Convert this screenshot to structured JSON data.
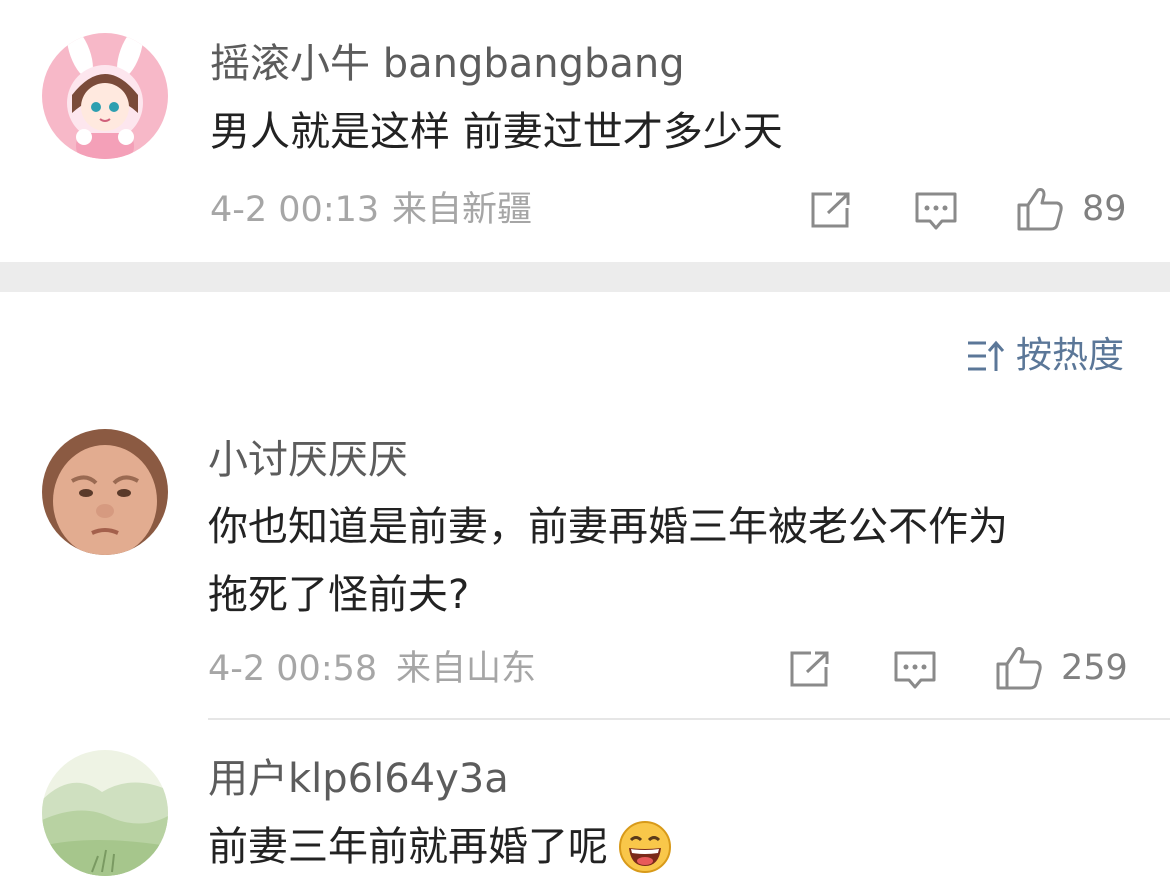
{
  "top_comment": {
    "username": "摇滚小牛 bangbangbang",
    "text": "男人就是这样 前妻过世才多少天",
    "timestamp": "4-2 00:13",
    "location": "来自新疆",
    "likes": "89"
  },
  "sort": {
    "label": "按热度",
    "icon": "sort-icon"
  },
  "comments": [
    {
      "username": "小讨厌厌厌",
      "text_lines": [
        "你也知道是前妻，前妻再婚三年被老公不作为",
        "拖死了怪前夫?"
      ],
      "timestamp": "4-2 00:58",
      "location": "来自山东",
      "likes": "259"
    },
    {
      "username": "用户klp6l64y3a",
      "text": "前妻三年前就再婚了呢",
      "emoji": "laughing-emoji"
    }
  ],
  "colors": {
    "link_blue": "#5b7798",
    "meta_gray": "#a6a6a6",
    "divider_gray": "#ececec"
  }
}
